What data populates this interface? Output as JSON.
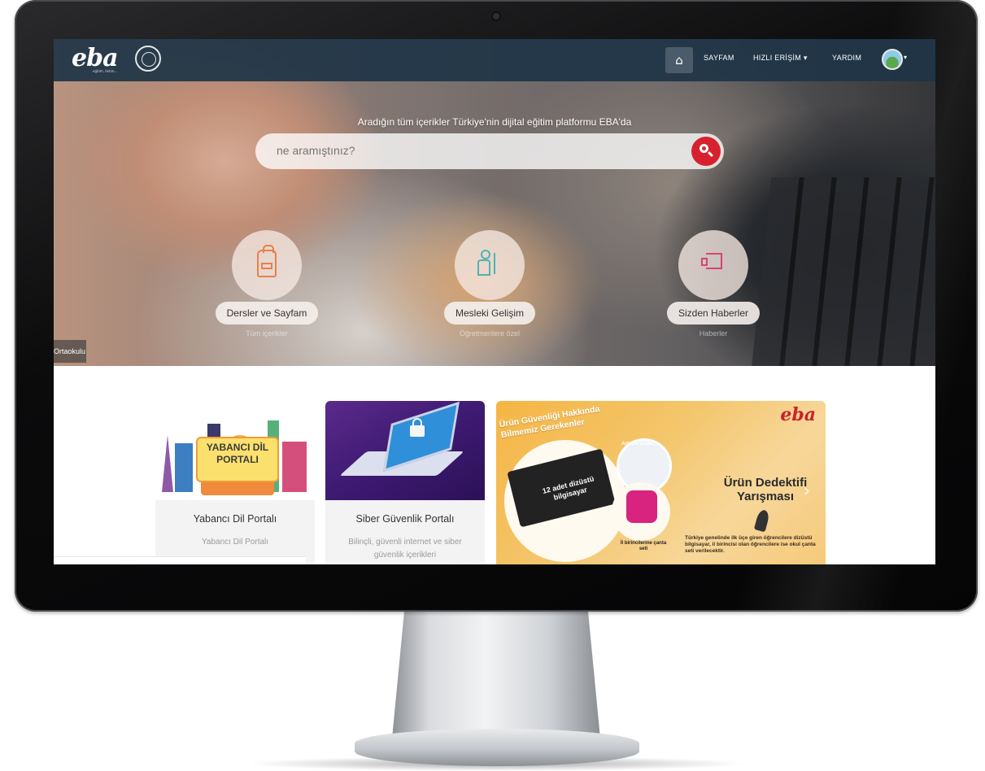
{
  "nav": {
    "logo": "eba",
    "logo_sub": "eğitim, iletim...",
    "home_icon": "home-icon",
    "items": [
      "SAYFAM",
      "HIZLI ERİŞİM",
      "YARDIM"
    ]
  },
  "hero": {
    "tagline": "Aradığın tüm içerikler Türkiye'nin dijital eğitim platformu EBA'da",
    "search_placeholder": "ne aramıştınız?",
    "categories": [
      {
        "label": "Dersler ve Sayfam",
        "sub": "Tüm içerikler",
        "icon": "backpack-icon"
      },
      {
        "label": "Mesleki Gelişim",
        "sub": "Öğretmenlere özel",
        "icon": "teacher-checklist-icon"
      },
      {
        "label": "Sizden Haberler",
        "sub": "Haberler",
        "icon": "megaphone-icon"
      }
    ],
    "school_tag": "Ortaokulu"
  },
  "cards": [
    {
      "title": "Yabancı Dil Portalı",
      "desc": "Yabancı Dil Portalı",
      "image_text": "YABANCI DİL PORTALI"
    },
    {
      "title": "Siber Güvenlik Portalı",
      "desc": "Bilinçli, güvenli internet ve siber güvenlik içerikleri"
    }
  ],
  "banner": {
    "logo": "eba",
    "heading": "Ürün Güvenliği Hakkında Bilmemiz Gerekenler",
    "laptop_text": "12 adet dizüstü bilgisayar",
    "city_text": "Ankara Gezisi",
    "bag_text": "İl birincilerine çanta seti",
    "title": "Ürün Dedektifi Yarışması",
    "desc": "Türkiye genelinde ilk üçe giren öğrencilere dizüstü bilgisayar, il birincisi olan öğrencilere ise okul çanta seti verilecektir."
  },
  "colors": {
    "accent": "#d7212f",
    "navbar": "#1e3446"
  }
}
